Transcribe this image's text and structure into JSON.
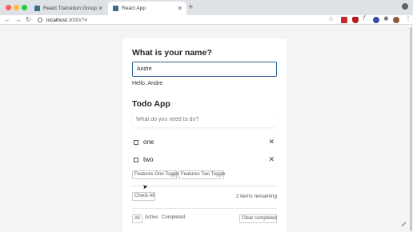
{
  "browser": {
    "tabs": [
      {
        "title": "React Transition Group",
        "close": "✕"
      },
      {
        "title": "React App",
        "close": "✕"
      }
    ],
    "new_tab": "+",
    "url_host": "localhost",
    "url_rest": ":3000/?#",
    "nav": {
      "back": "←",
      "forward": "→",
      "reload": "↻"
    },
    "icons": {
      "star": "☆",
      "func": "ƒ",
      "puzzle": "✱",
      "menu": "⋮"
    }
  },
  "page": {
    "name_heading": "What is your name?",
    "name_value": "Andre",
    "greeting": "Hello, Andre",
    "todo_heading": "Todo App",
    "todo_placeholder": "What do you need to do?",
    "todos": [
      {
        "text": "one",
        "delete": "✕"
      },
      {
        "text": "two",
        "delete": "✕"
      }
    ],
    "feature_toggles": [
      "Features One Toggle",
      "Features Two Toggle"
    ],
    "check_all": "Check All",
    "remaining": "2 items remaining",
    "filters": [
      "All",
      "Active",
      "Completed"
    ],
    "clear_completed": "Clear completed"
  }
}
